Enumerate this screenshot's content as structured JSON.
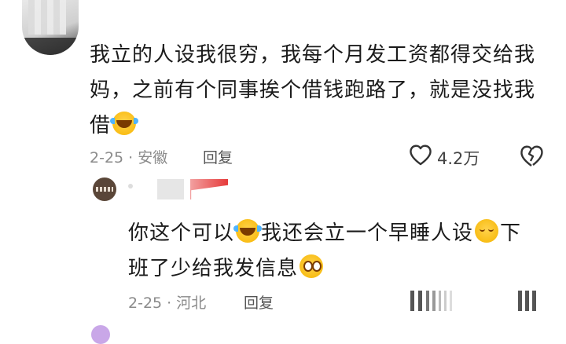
{
  "comment1": {
    "lines": [
      "我立的人设我很穷，我每个月发工资都得交给我",
      "妈，之前有个同事挨个借钱跑路了，就是没找我",
      "借"
    ],
    "emoji_end": "cry-laugh-icon",
    "date_location": "2-25 · 安徽",
    "reply_label": "回复",
    "like_count": "4.2万"
  },
  "reply1": {
    "parts": [
      "你这个可以",
      "我还会立一个早睡人设",
      "下",
      "班了少给我发信息"
    ],
    "emojis": [
      "cry-laugh-icon",
      "sleepy-icon",
      "flushed-icon"
    ],
    "date_location": "2-25 · 河北",
    "reply_label": "回复"
  },
  "colors": {
    "text": "#1b1b1b",
    "meta": "#8a8a8a",
    "accent_red": "#e63b3b"
  }
}
